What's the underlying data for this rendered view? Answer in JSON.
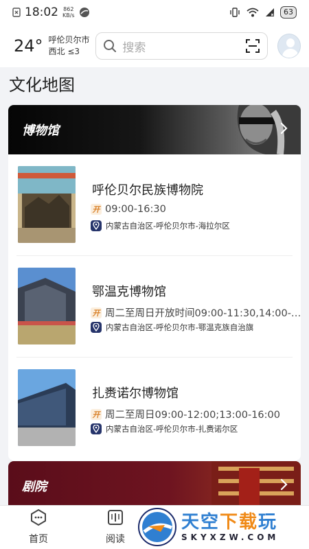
{
  "status_bar": {
    "time": "18:02",
    "net_speed_value": "862",
    "net_speed_unit": "KB/s",
    "battery": "63"
  },
  "header": {
    "temperature": "24°",
    "city": "呼伦贝尔市",
    "wind": "西北 ≤3",
    "search_placeholder": "搜索"
  },
  "page_title": "文化地图",
  "categories": [
    {
      "title": "博物馆",
      "items": [
        {
          "name": "呼伦贝尔民族博物院",
          "hours": "09:00-16:30",
          "address": "内蒙古自治区-呼伦贝尔市-海拉尔区"
        },
        {
          "name": "鄂温克博物馆",
          "hours": "周二至周日开放时间09:00-11:30,14:00-…",
          "address": "内蒙古自治区-呼伦贝尔市-鄂温克族自治旗"
        },
        {
          "name": "扎赉诺尔博物馆",
          "hours": "周二至周日09:00-12:00;13:00-16:00",
          "address": "内蒙古自治区-呼伦贝尔市-扎赉诺尔区"
        }
      ]
    },
    {
      "title": "剧院"
    }
  ],
  "badge_open_text": "开",
  "bottom_nav": {
    "home": "首页",
    "read": "阅读"
  },
  "watermark": {
    "main_a": "天空",
    "main_b": "下载",
    "main_c": "玩",
    "sub": "SKYXZW.COM"
  },
  "colors": {
    "badge_open_bg": "#fbeedd",
    "badge_open_fg": "#d9822b",
    "badge_loc_bg": "#26346b",
    "theatre_banner": "#5a0d1a"
  }
}
